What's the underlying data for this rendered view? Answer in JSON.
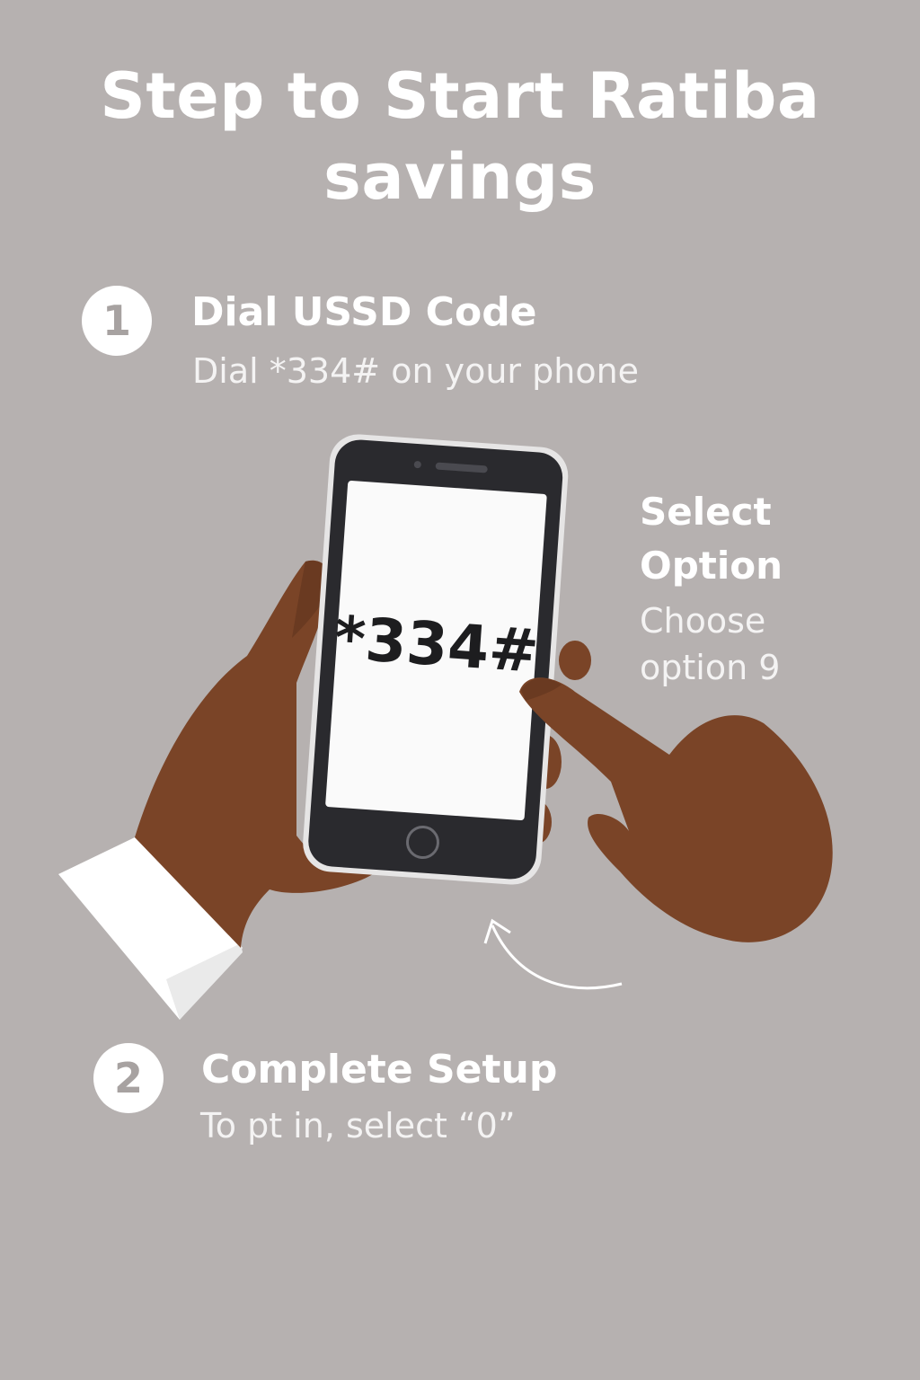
{
  "title": "Step to Start Ratiba savings",
  "steps": [
    {
      "number": "1",
      "heading": "Dial USSD Code",
      "description": "Dial *334# on your phone"
    },
    {
      "number": "2",
      "heading": "Complete Setup",
      "description": "To pt in, select “0”"
    }
  ],
  "side_step": {
    "heading": "Select Option",
    "description": "Choose option 9"
  },
  "phone": {
    "screen_text": "*334#"
  },
  "colors": {
    "background": "#b6b1b0",
    "skin": "#7a4427",
    "phone_body": "#2a2a2e",
    "text": "#ffffff"
  },
  "icons": [
    "hand-holding-phone-illustration",
    "pointing-hand-illustration",
    "curved-arrow-icon"
  ]
}
